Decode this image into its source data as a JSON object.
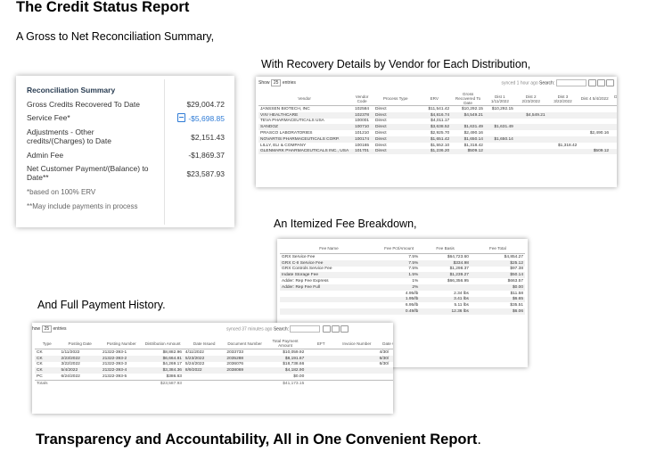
{
  "title": "The Credit Status Report",
  "subtitle1": "A Gross to Net Reconciliation Summary,",
  "subtitle2": "With Recovery Details by Vendor for Each Distribution,",
  "subtitle3": "An Itemized Fee Breakdown,",
  "subtitle4": "And Full Payment History.",
  "bottom_line": "Transparency and Accountability, All in One Convenient Report",
  "bottom_period": ".",
  "reconciliation": {
    "header": "Reconciliation Summary",
    "rows": [
      {
        "label": "Gross Credits Recovered To Date",
        "value": "$29,004.72"
      },
      {
        "label": "Service Fee*",
        "value": "-$5,698.85"
      },
      {
        "label": "Adjustments - Other credits/(Charges) to Date",
        "value": "$2,151.43"
      },
      {
        "label": "Admin Fee",
        "value": "-$1,869.37"
      },
      {
        "label": "Net Customer Payment/(Balance) to Date**",
        "value": "$23,587.93"
      }
    ],
    "note1": "*based on 100% ERV",
    "note2": "**May include payments in process"
  },
  "vendor_table": {
    "show_prefix": "Show",
    "show_value": "25",
    "show_suffix": "entries",
    "synced": "synced 1 hour ago",
    "search_label": "Search:",
    "headers": [
      "Vendor",
      "Vendor Code",
      "Process Type",
      "ERV",
      "Gross Recovered To Date",
      "Dist 1 1/11/2022",
      "Dist 2 2/23/2022",
      "Dist 3 3/22/2022",
      "Dist 4 5/4/2022",
      "Dist 5 6/2"
    ],
    "rows": [
      [
        "JANSSEN BIOTECH, INC",
        "102584",
        "Direct",
        "$11,541.42",
        "$10,292.15",
        "$10,292.15",
        "",
        "",
        "",
        ""
      ],
      [
        "VIIV HEALTHCARE",
        "102378",
        "Direct",
        "$4,816.74",
        "$4,549.21",
        "",
        "$4,549.21",
        "",
        "",
        ""
      ],
      [
        "TEVA PHARMACEUTICALS USA",
        "100001",
        "Direct",
        "$4,011.17",
        "",
        "",
        "",
        "",
        "",
        ""
      ],
      [
        "SANDOZ",
        "100710",
        "Direct",
        "$3,638.52",
        "$1,631.49",
        "$1,631.49",
        "",
        "",
        "",
        ""
      ],
      [
        "PRASCO LABORATORIES",
        "101210",
        "Direct",
        "$2,925.70",
        "$2,490.16",
        "",
        "",
        "",
        "$2,490.16",
        ""
      ],
      [
        "NOVARTIS PHARMACEUTICALS CORP.",
        "100174",
        "Direct",
        "$1,651.42",
        "$1,650.14",
        "$1,650.14",
        "",
        "",
        "",
        ""
      ],
      [
        "LILLY, ELI & COMPANY",
        "100165",
        "Direct",
        "$1,552.10",
        "$1,318.42",
        "",
        "",
        "$1,318.42",
        "",
        ""
      ],
      [
        "GLENMARK PHARMACEUTICALS INC., USA",
        "101701",
        "Direct",
        "$1,236.20",
        "$509.12",
        "",
        "",
        "",
        "$509.12",
        ""
      ]
    ]
  },
  "fee_table": {
    "headers": [
      "Fee Name",
      "Fee Pct/Amount",
      "Fee Basis",
      "Fee Total"
    ],
    "rows": [
      [
        "GRX Service Fee",
        "7.5%",
        "$64,723.60",
        "$4,854.27"
      ],
      [
        "GRX C-II Service Fee",
        "7.5%",
        "$334.98",
        "$25.12"
      ],
      [
        "GRX Controls Service Fee",
        "7.5%",
        "$1,298.37",
        "$97.38"
      ],
      [
        "Indate Storage Fee",
        "1.5%",
        "$1,239.27",
        "$50.14"
      ],
      [
        "Adder: Rep Fee Express",
        "1%",
        "$66,356.95",
        "$663.57"
      ],
      [
        "Adder: Rep Fee Full",
        "2%",
        "",
        "$0.00"
      ],
      [
        "",
        "4.95/lb",
        "2.34 lbs",
        "$11.58"
      ],
      [
        "",
        "1.95/lb",
        "3.41 lbs",
        "$6.65"
      ],
      [
        "",
        "6.95/lb",
        "5.11 lbs",
        "$35.51"
      ],
      [
        "",
        "0.49/lb",
        "12.36 lbs",
        "$6.06"
      ]
    ]
  },
  "payment_table": {
    "show_prefix": "how",
    "show_value": "25",
    "show_suffix": "entries",
    "synced": "synced 37 minutes ago",
    "search_label": "Search:",
    "headers": [
      "Type",
      "Posting Date",
      "Posting Number",
      "Distribution Amount",
      "Date Issued",
      "Document Number",
      "Total Payment Amount",
      "EFT",
      "Invoice Number",
      "Date C"
    ],
    "rows": [
      [
        "CK",
        "1/11/2022",
        "21322-393-1",
        "$8,882.96",
        "4/11/2022",
        "2033733",
        "$10,059.92",
        "",
        "",
        "4/30/"
      ],
      [
        "CK",
        "2/23/2022",
        "21322-393-2",
        "$6,664.81",
        "5/23/2022",
        "2035288",
        "$8,191.67",
        "",
        "",
        "6/30/"
      ],
      [
        "CK",
        "3/22/2022",
        "21322-393-3",
        "$4,269.17",
        "5/24/2022",
        "2036076",
        "$18,738.66",
        "",
        "",
        "6/30/"
      ],
      [
        "CK",
        "5/4/2022",
        "21322-393-4",
        "$3,384.36",
        "8/9/2022",
        "2038069",
        "$4,182.90",
        "",
        "",
        ""
      ],
      [
        "PC",
        "6/24/2022",
        "21322-393-5",
        "$386.63",
        "",
        "",
        "$0.00",
        "",
        "",
        ""
      ]
    ],
    "totals": [
      "Totals",
      "",
      "",
      "$23,587.93",
      "",
      "",
      "$41,173.15",
      "",
      "",
      ""
    ]
  }
}
